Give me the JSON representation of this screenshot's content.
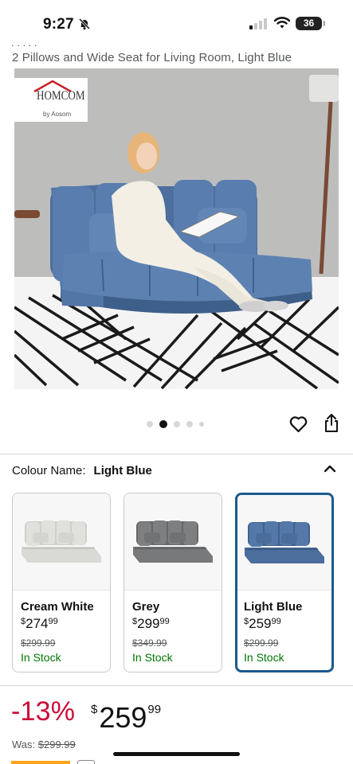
{
  "status_bar": {
    "time": "9:27",
    "battery": "36"
  },
  "product": {
    "cut_line": ", , , , ,",
    "title": "2 Pillows and Wide Seat for Living Room, Light Blue",
    "logo": {
      "brand": "HOMCOM",
      "sub": "by Aosom"
    },
    "image_dots": {
      "count": 5,
      "active_index": 1
    }
  },
  "colour": {
    "label": "Colour Name:",
    "value": "Light Blue",
    "options": [
      {
        "name": "Cream White",
        "price_symbol": "$",
        "price_whole": "274",
        "price_cents": "99",
        "old_price": "$299.99",
        "stock": "In Stock",
        "sofa_color": "#d8d8d5"
      },
      {
        "name": "Grey",
        "price_symbol": "$",
        "price_whole": "299",
        "price_cents": "99",
        "old_price": "$349.99",
        "stock": "In Stock",
        "sofa_color": "#77797b"
      },
      {
        "name": "Light Blue",
        "price_symbol": "$",
        "price_whole": "259",
        "price_cents": "99",
        "old_price": "$299.99",
        "stock": "In Stock",
        "sofa_color": "#4b6e9c"
      }
    ],
    "selected_index": 2
  },
  "price_block": {
    "discount": "-13%",
    "currency": "$",
    "whole": "259",
    "cents": "99",
    "was_label": "Was:",
    "was_value": "$299.99"
  },
  "colors": {
    "accent_red": "#cc0c39",
    "stock_green": "#007600",
    "selected_border": "#1b5a8d"
  },
  "icons": [
    "bell-slash-icon",
    "cellular-signal-icon",
    "wifi-icon",
    "battery-icon",
    "heart-icon",
    "share-icon",
    "chevron-up-icon"
  ]
}
